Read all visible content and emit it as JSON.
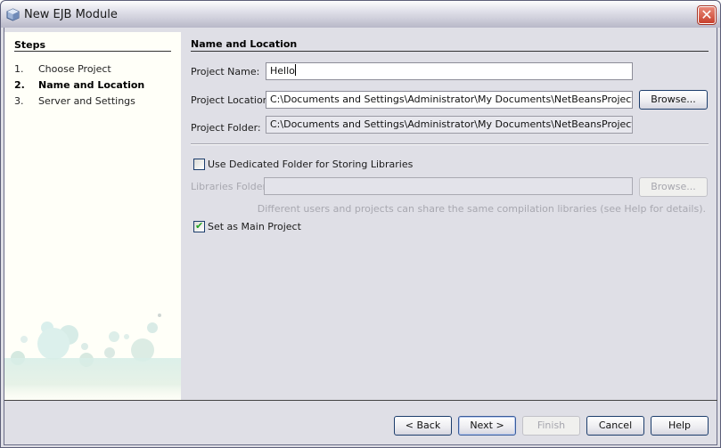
{
  "window": {
    "title": "New EJB Module",
    "icon": "cube-icon",
    "close_icon": "close-icon"
  },
  "steps": {
    "title": "Steps",
    "items": [
      {
        "num": "1.",
        "label": "Choose Project",
        "active": false
      },
      {
        "num": "2.",
        "label": "Name and Location",
        "active": true
      },
      {
        "num": "3.",
        "label": "Server and Settings",
        "active": false
      }
    ]
  },
  "main": {
    "section_title": "Name and Location",
    "project_name": {
      "label": "Project Name:",
      "value": "Hello"
    },
    "project_location": {
      "label": "Project Location:",
      "value": "C:\\Documents and Settings\\Administrator\\My Documents\\NetBeansProjects",
      "browse_label": "Browse..."
    },
    "project_folder": {
      "label": "Project Folder:",
      "value": "C:\\Documents and Settings\\Administrator\\My Documents\\NetBeansProjects\\Hello"
    },
    "dedicated_folder": {
      "label": "Use Dedicated Folder for Storing Libraries",
      "checked": false
    },
    "libraries_folder": {
      "label": "Libraries Folder:",
      "value": "",
      "browse_label": "Browse..."
    },
    "libraries_hint": "Different users and projects can share the same compilation libraries (see Help for details).",
    "main_project": {
      "label": "Set as Main Project",
      "checked": true
    }
  },
  "footer": {
    "back_label": "< Back",
    "next_label": "Next >",
    "finish_label": "Finish",
    "cancel_label": "Cancel",
    "help_label": "Help"
  }
}
